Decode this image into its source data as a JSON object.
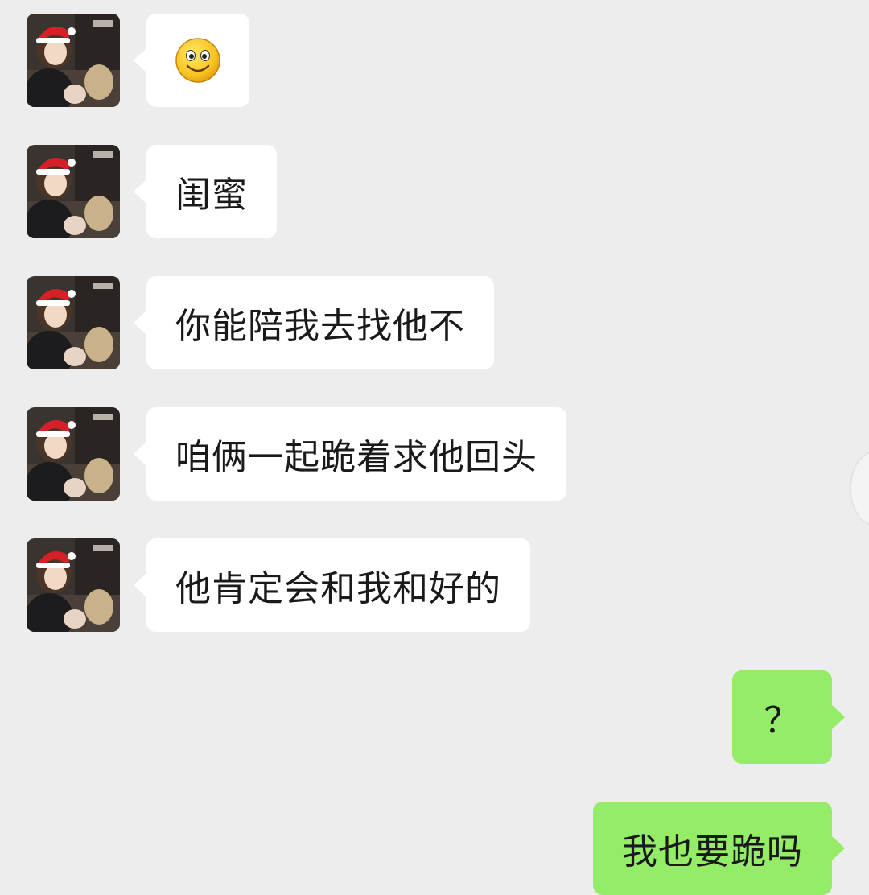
{
  "conversation": {
    "messages": [
      {
        "sender": "contact",
        "type": "emoji",
        "emoji": "smiley-face",
        "text": ""
      },
      {
        "sender": "contact",
        "type": "text",
        "text": "闺蜜"
      },
      {
        "sender": "contact",
        "type": "text",
        "text": "你能陪我去找他不"
      },
      {
        "sender": "contact",
        "type": "text",
        "text": "咱俩一起跪着求他回头"
      },
      {
        "sender": "contact",
        "type": "text",
        "text": "他肯定会和我和好的"
      },
      {
        "sender": "self",
        "type": "text",
        "text": "？"
      },
      {
        "sender": "self",
        "type": "text",
        "text": "我也要跪吗"
      }
    ]
  },
  "contact": {
    "avatar_icon": "avatar-photo-santa-hat"
  },
  "colors": {
    "background": "#ededed",
    "incoming_bubble": "#ffffff",
    "outgoing_bubble": "#95ec69",
    "text": "#1a1a1a"
  }
}
